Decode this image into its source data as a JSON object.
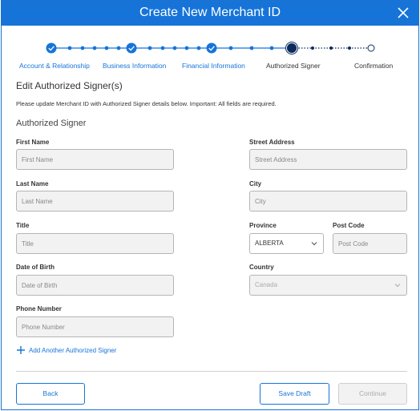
{
  "header": {
    "title": "Create New Merchant ID",
    "close_icon": "close-icon"
  },
  "stepper": {
    "steps": [
      {
        "label": "Account & Relationship",
        "state": "complete"
      },
      {
        "label": "Business Information",
        "state": "complete"
      },
      {
        "label": "Financial Information",
        "state": "complete"
      },
      {
        "label": "Authorized Signer",
        "state": "active"
      },
      {
        "label": "Confirmation",
        "state": "upcoming"
      }
    ],
    "colors": {
      "complete": "#1674d9",
      "active": "#0b2b5c",
      "upcoming": "#1674d9"
    }
  },
  "form": {
    "section_title": "Edit Authorized Signer(s)",
    "instructions": "Please update Merchant ID with Authorized Signer details below. Important: All fields are required.",
    "subsection_title": "Authorized Signer",
    "first_name": {
      "label": "First Name",
      "placeholder": "First Name"
    },
    "last_name": {
      "label": "Last Name",
      "placeholder": "Last Name"
    },
    "title": {
      "label": "Title",
      "placeholder": "Title"
    },
    "dob": {
      "label": "Date of Birth",
      "placeholder": "Date of Birth"
    },
    "phone": {
      "label": "Phone Number",
      "placeholder": "Phone Number"
    },
    "street": {
      "label": "Street Address",
      "placeholder": "Street Address"
    },
    "city": {
      "label": "City",
      "placeholder": "City"
    },
    "province": {
      "label": "Province",
      "value": "ALBERTA"
    },
    "postcode": {
      "label": "Post Code",
      "placeholder": "Post Code"
    },
    "country": {
      "label": "Country",
      "value": "Canada"
    },
    "add_signer": "Add Another Authorized Signer"
  },
  "footer": {
    "back": "Back",
    "save_draft": "Save Draft",
    "continue": "Continue"
  }
}
